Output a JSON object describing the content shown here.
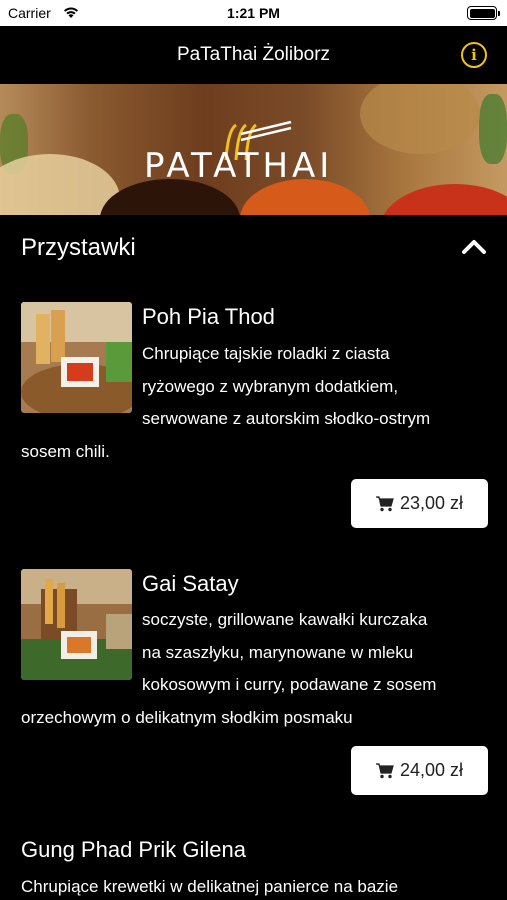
{
  "status_bar": {
    "carrier": "Carrier",
    "time": "1:21 PM"
  },
  "nav": {
    "title": "PaTaThai Żoliborz",
    "info_icon": "info-icon"
  },
  "banner": {
    "logo_text": "PATATHAI"
  },
  "section": {
    "title": "Przystawki",
    "chevron_icon": "chevron-up-icon"
  },
  "items": [
    {
      "name": "Poh Pia Thod",
      "description": "Chrupiące tajskie roladki z ciasta ryżowego z wybranym dodatkiem, serwowane z autorskim słodko-ostrym sosem chili.",
      "price": "23,00 zł"
    },
    {
      "name": "Gai Satay",
      "description": "soczyste, grillowane kawałki kurczaka na szaszłyku, marynowane w mleku kokosowym i curry, podawane z sosem orzechowym o delikatnym słodkim posmaku",
      "price": "24,00 zł"
    },
    {
      "name": "Gung Phad Prik Gilena",
      "description": "Chrupiące krewetki w delikatnej panierce na bazie"
    }
  ],
  "colors": {
    "accent": "#f1c21b",
    "background": "#000000",
    "button_bg": "#ffffff"
  }
}
